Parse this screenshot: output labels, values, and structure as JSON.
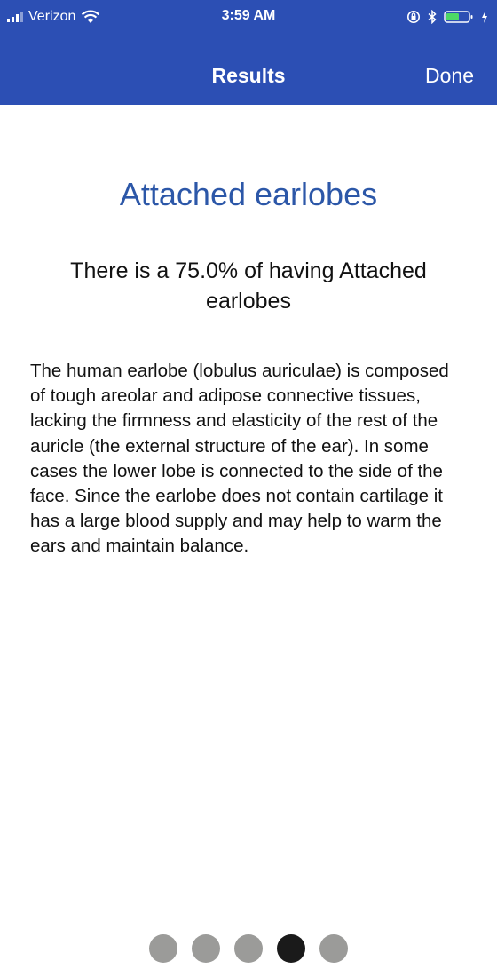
{
  "status_bar": {
    "carrier": "Verizon",
    "time": "3:59 AM",
    "signal_icon": "signal-bars-icon",
    "wifi_icon": "wifi-icon",
    "battery_icon": "battery-icon",
    "battery_color": "#4cd964"
  },
  "nav": {
    "title": "Results",
    "done_label": "Done",
    "background_color": "#2c4fb4"
  },
  "result": {
    "title": "Attached earlobes",
    "probability_text": "There is a 75.0% of having Attached earlobes",
    "description": "The human earlobe (lobulus auriculae) is composed of tough areolar and adipose connective tissues, lacking the firmness and elasticity of the rest of the auricle (the external structure of the ear). In some cases the lower lobe is connected to the side of the face. Since the earlobe does not contain cartilage it has a large blood supply and may help to warm the ears and maintain balance."
  },
  "pagination": {
    "total_pages": 5,
    "current_page": 4
  }
}
